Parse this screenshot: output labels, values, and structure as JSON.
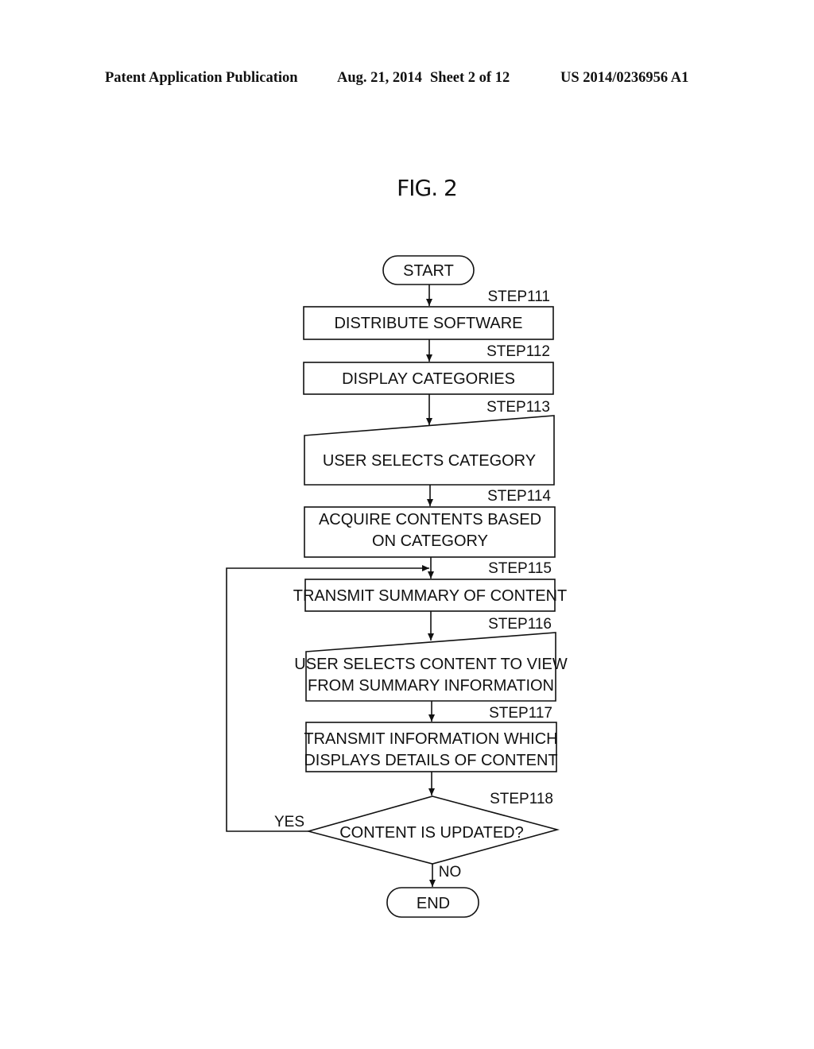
{
  "header": {
    "publication_type": "Patent Application Publication",
    "date": "Aug. 21, 2014",
    "sheet": "Sheet 2 of 12",
    "publication_number": "US 2014/0236956 A1"
  },
  "figure": {
    "title": "FIG. 2"
  },
  "flowchart": {
    "start": "START",
    "end": "END",
    "steps": [
      {
        "id": "STEP111",
        "lines": [
          "DISTRIBUTE SOFTWARE"
        ],
        "shape": "process"
      },
      {
        "id": "STEP112",
        "lines": [
          "DISPLAY CATEGORIES"
        ],
        "shape": "process"
      },
      {
        "id": "STEP113",
        "lines": [
          "USER SELECTS CATEGORY"
        ],
        "shape": "manual-input"
      },
      {
        "id": "STEP114",
        "lines": [
          "ACQUIRE CONTENTS BASED",
          "ON CATEGORY"
        ],
        "shape": "process"
      },
      {
        "id": "STEP115",
        "lines": [
          "TRANSMIT SUMMARY OF CONTENT"
        ],
        "shape": "process"
      },
      {
        "id": "STEP116",
        "lines": [
          "USER SELECTS CONTENT TO VIEW",
          "FROM SUMMARY INFORMATION"
        ],
        "shape": "manual-input"
      },
      {
        "id": "STEP117",
        "lines": [
          "TRANSMIT INFORMATION WHICH",
          "DISPLAYS DETAILS OF CONTENT"
        ],
        "shape": "process"
      },
      {
        "id": "STEP118",
        "lines": [
          "CONTENT IS UPDATED?"
        ],
        "shape": "decision"
      }
    ],
    "decision_labels": {
      "yes": "YES",
      "no": "NO"
    }
  }
}
